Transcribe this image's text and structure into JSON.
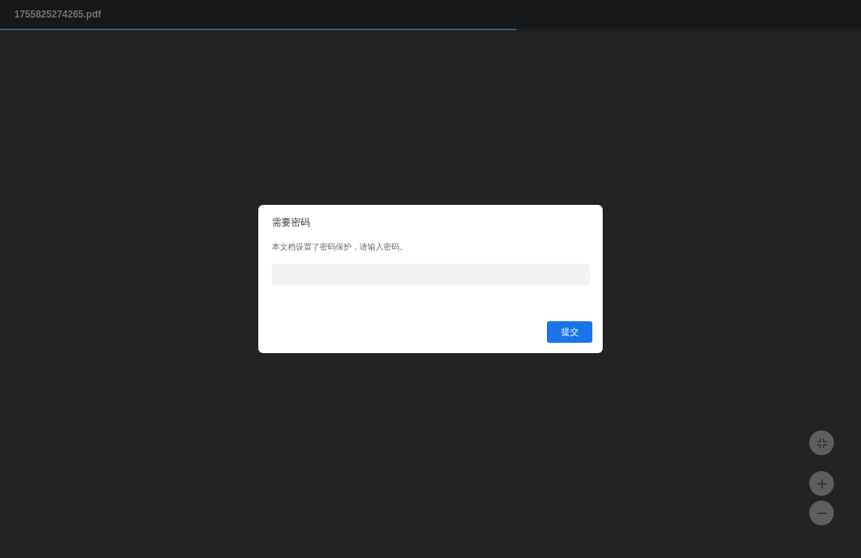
{
  "header": {
    "title": "1755825274265.pdf",
    "progress": {
      "level": 0.6
    }
  },
  "dialog": {
    "title": "需要密码",
    "message": "本文档设置了密码保护，请输入密码。",
    "submit": "提交"
  },
  "zoom_controls": [
    {
      "kind": "fit"
    },
    {
      "kind": "zoom-in"
    },
    {
      "kind": "zoom-out"
    }
  ]
}
